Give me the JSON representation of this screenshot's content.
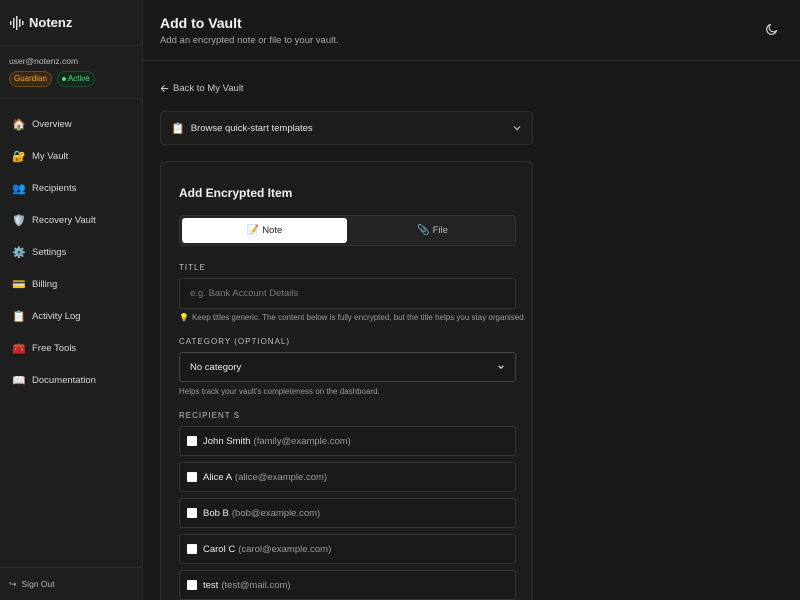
{
  "app": {
    "name": "Notenz"
  },
  "user": {
    "email": "user@notenz.com",
    "plan_badge": "Guardian",
    "status_badge": "Active"
  },
  "sidebar": {
    "items": [
      {
        "label": "Overview",
        "icon": "🏠"
      },
      {
        "label": "My Vault",
        "icon": "🔐"
      },
      {
        "label": "Recipients",
        "icon": "👥"
      },
      {
        "label": "Recovery Vault",
        "icon": "🛡️"
      },
      {
        "label": "Settings",
        "icon": "⚙️"
      },
      {
        "label": "Billing",
        "icon": "💳"
      },
      {
        "label": "Activity Log",
        "icon": "📋"
      },
      {
        "label": "Free Tools",
        "icon": "🧰"
      },
      {
        "label": "Documentation",
        "icon": "📖"
      }
    ],
    "signout_label": "Sign Out",
    "signout_icon": "↪"
  },
  "header": {
    "title": "Add to Vault",
    "subtitle": "Add an encrypted note or file to your vault."
  },
  "main": {
    "back_label": "Back to My Vault",
    "templates_icon": "📋",
    "templates_label": "Browse quick-start templates",
    "form": {
      "title": "Add Encrypted Item",
      "tabs": {
        "note_icon": "📝",
        "note_label": "Note",
        "file_icon": "📎",
        "file_label": "File"
      },
      "title_label": "TITLE",
      "title_placeholder": "e.g. Bank Account Details",
      "title_value": "",
      "title_hint_icon": "💡",
      "title_hint": "Keep titles generic. The content below is fully encrypted, but the title helps you stay organised.",
      "category_label": "CATEGORY (OPTIONAL)",
      "category_value": "No category",
      "category_hint": "Helps track your vault's completeness on the dashboard.",
      "recipients_label": "RECIPIENT S",
      "recipients": [
        {
          "name": "John Smith",
          "email": "(family@example.com)"
        },
        {
          "name": "Alice A",
          "email": "(alice@example.com)"
        },
        {
          "name": "Bob B",
          "email": "(bob@example.com)"
        },
        {
          "name": "Carol C",
          "email": "(carol@example.com)"
        },
        {
          "name": "test",
          "email": "(test@mail.com)"
        }
      ]
    }
  }
}
